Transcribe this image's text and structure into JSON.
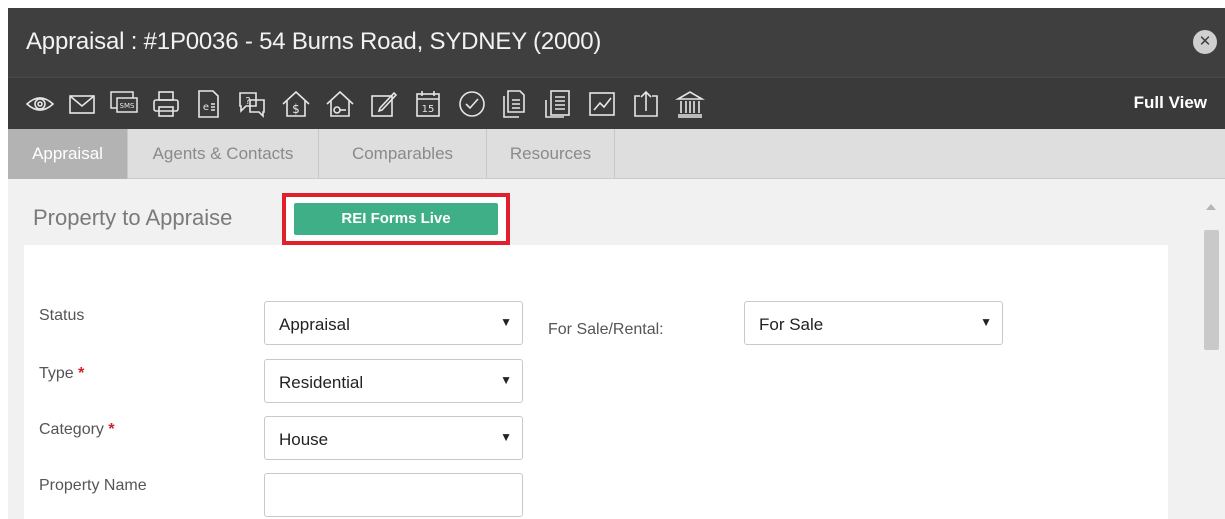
{
  "window": {
    "title": "Appraisal : #1P0036 - 54 Burns Road, SYDNEY (2000)",
    "close_icon": "close-icon"
  },
  "toolbar": {
    "icons": [
      "eye-icon",
      "envelope-icon",
      "sms-icon",
      "print-icon",
      "e-document-icon",
      "questions-icon",
      "house-dollar-icon",
      "house-key-icon",
      "edit-note-icon",
      "calendar-icon",
      "checkmark-circle-icon",
      "documents-icon",
      "report-icon",
      "chart-icon",
      "upload-icon",
      "bank-icon"
    ],
    "calendar_day": "15",
    "sms_text": "SMS",
    "full_view_label": "Full View"
  },
  "tabs": [
    {
      "label": "Appraisal",
      "active": true
    },
    {
      "label": "Agents & Contacts",
      "active": false
    },
    {
      "label": "Comparables",
      "active": false
    },
    {
      "label": "Resources",
      "active": false
    }
  ],
  "section": {
    "title": "Property to Appraise",
    "rei_button": "REI Forms Live"
  },
  "form": {
    "status_label": "Status",
    "status_value": "Appraisal",
    "sale_rental_label": "For Sale/Rental:",
    "sale_rental_value": "For Sale",
    "type_label": "Type",
    "type_value": "Residential",
    "category_label": "Category",
    "category_value": "House",
    "property_name_label": "Property Name",
    "property_name_value": "",
    "required_mark": "*",
    "caret": "▼"
  },
  "colors": {
    "title_bar": "#3f3f3f",
    "toolbar": "#3a3a3a",
    "active_tab": "#b3b3b3",
    "rei_button": "#3faf87",
    "highlight_frame": "#e0202a",
    "required": "#d0202a"
  }
}
